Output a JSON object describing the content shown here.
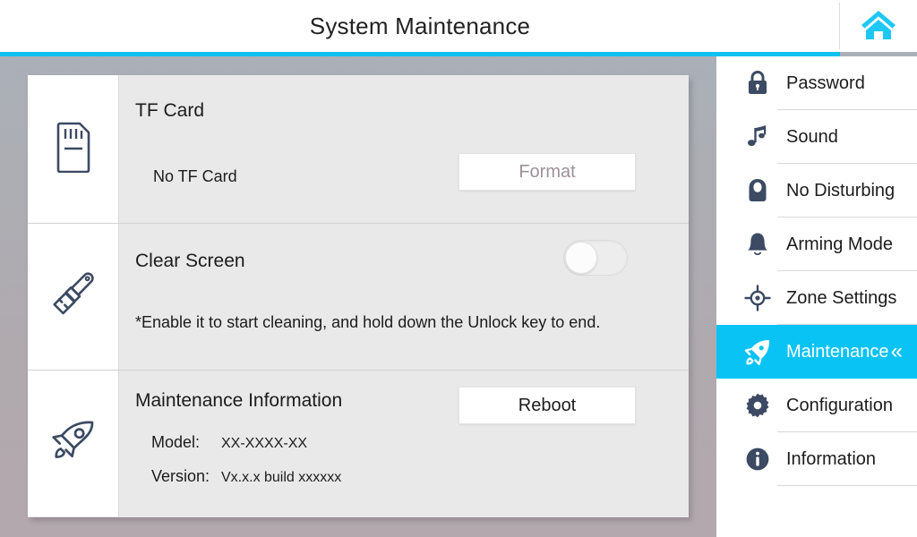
{
  "header": {
    "title": "System Maintenance",
    "home_icon": "home-icon"
  },
  "colors": {
    "accent_cyan": "#0ac3f5",
    "header_bar_cyan": "#0fc0f0",
    "icon_navy": "#3c4a63",
    "panel_bg": "#e9e9e9",
    "desktop_bg": "#adaeb3",
    "disabled_text": "#9d9199",
    "text": "#1c1c1c"
  },
  "panel": {
    "rows": [
      {
        "icon": "sd-card-icon",
        "title": "TF Card",
        "status": "No TF Card",
        "button": {
          "label": "Format",
          "disabled": true
        }
      },
      {
        "icon": "paintbrush-icon",
        "title": "Clear Screen",
        "note": "*Enable it to start cleaning, and hold down the Unlock key to end.",
        "toggle": {
          "name": "clear-screen-toggle",
          "state": "off"
        }
      },
      {
        "icon": "rocket-icon",
        "title": "Maintenance Information",
        "button": {
          "label": "Reboot",
          "disabled": false
        },
        "fields": [
          {
            "label": "Model:",
            "value": "XX-XXXX-XX"
          },
          {
            "label": "Version:",
            "value": "Vx.x.x build xxxxxx"
          }
        ]
      }
    ]
  },
  "sidebar": {
    "items": [
      {
        "label": "Password",
        "icon": "lock-icon",
        "active": false
      },
      {
        "label": "Sound",
        "icon": "music-note-icon",
        "active": false
      },
      {
        "label": "No Disturbing",
        "icon": "door-hanger-icon",
        "active": false
      },
      {
        "label": "Arming Mode",
        "icon": "bell-icon",
        "active": false
      },
      {
        "label": "Zone Settings",
        "icon": "crosshair-icon",
        "active": false
      },
      {
        "label": "Maintenance",
        "icon": "rocket-icon",
        "active": true,
        "chevron": "«"
      },
      {
        "label": "Configuration",
        "icon": "gear-icon",
        "active": false
      },
      {
        "label": "Information",
        "icon": "info-circle-icon",
        "active": false
      }
    ]
  }
}
